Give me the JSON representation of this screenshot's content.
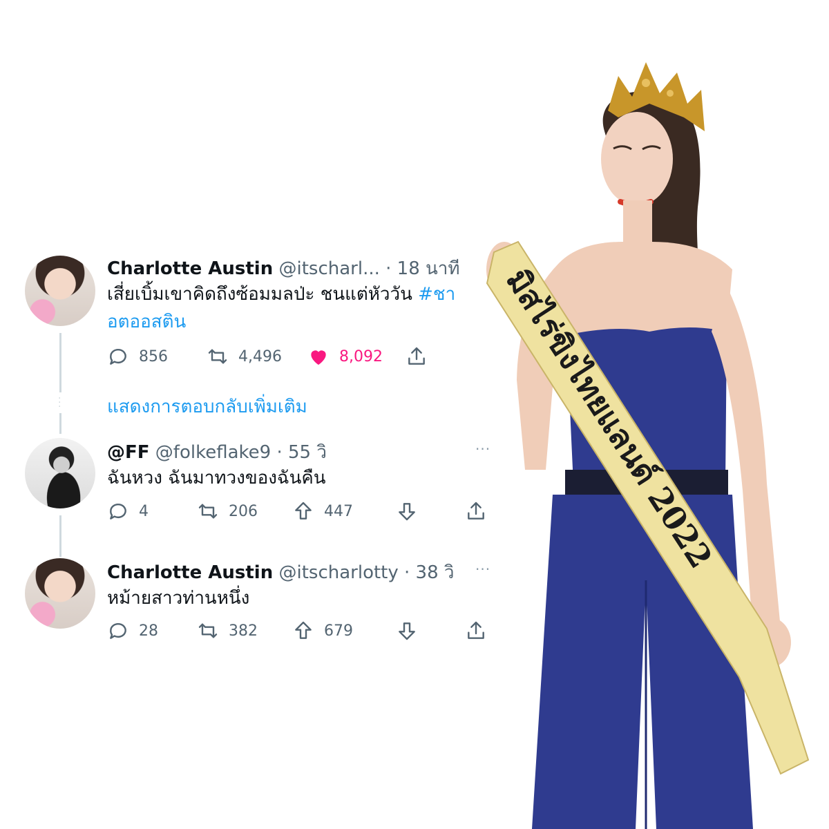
{
  "tweets": [
    {
      "name": "Charlotte Austin",
      "handle": "@itscharl...",
      "time": "· 18 นาที",
      "text_line1": "เสี่ยเบิ้มเขาคิดถึงซ้อมมลป่ะ ชนแต่หัววัน",
      "hashtag": "#ชา",
      "text_line2": "อตออสติน",
      "replies": "856",
      "retweets": "4,496",
      "likes": "8,092"
    },
    {
      "name": "@FF",
      "handle": "@folkeflake9",
      "time": "· 55 วิ",
      "more": "···",
      "text": "ฉันหวง ฉันมาทวงของฉันคืน",
      "replies": "4",
      "retweets": "206",
      "upvotes": "447"
    },
    {
      "name": "Charlotte Austin",
      "handle": "@itscharlotty",
      "time": "· 38 วิ",
      "more": "···",
      "text": "หม้ายสาวท่านหนึ่ง",
      "replies": "28",
      "retweets": "382",
      "upvotes": "679"
    }
  ],
  "show_more_replies": "แสดงการตอบกลับเพิ่มเติม",
  "photo": {
    "sash_text": "มิสไร่ขิงไทยแลนด์ 2022",
    "dress_color": "#2f3b8f",
    "sash_color": "#efe2a0"
  },
  "colors": {
    "link": "#1d9bf0",
    "like": "#f91880",
    "muted": "#536471"
  }
}
